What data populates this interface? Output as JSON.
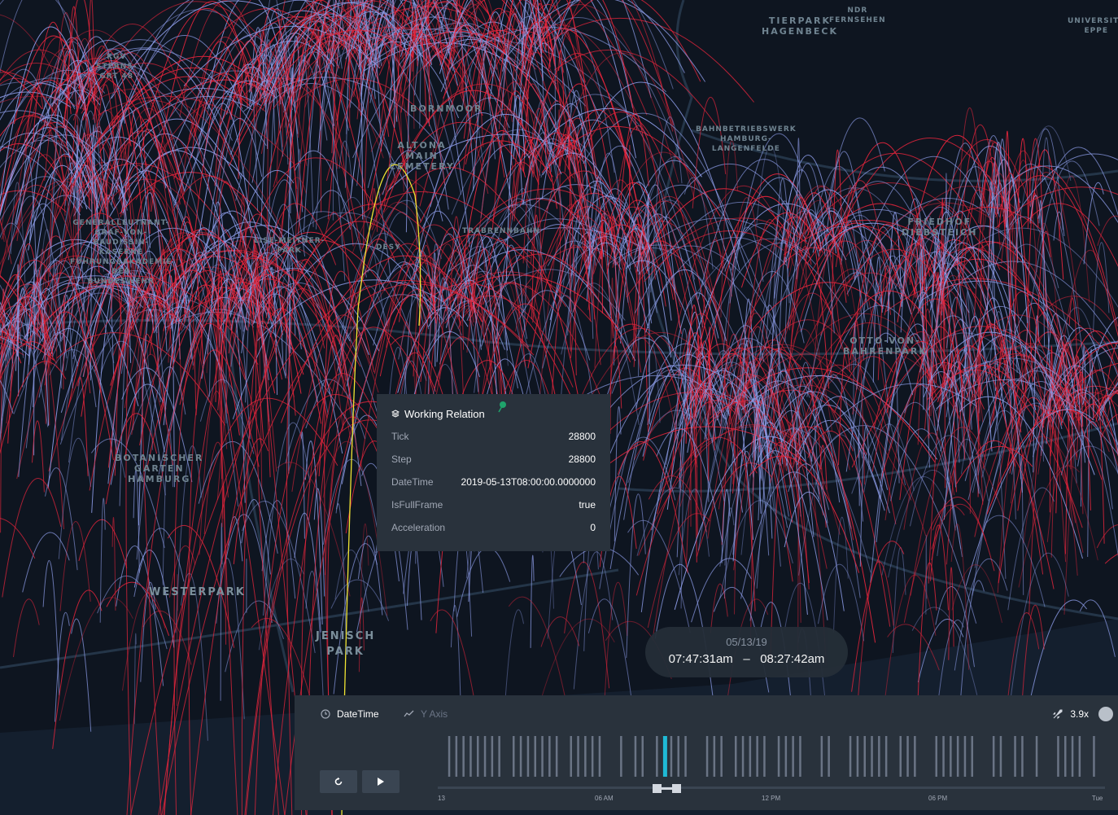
{
  "map": {
    "labels": [
      {
        "id": "kgv",
        "text": "KGV\nSTERNS-\nGRT 48",
        "size": "small"
      },
      {
        "id": "bornmoor",
        "text": "BORNMOOR",
        "size": "normal"
      },
      {
        "id": "altona",
        "text": "ALTONA\nMAIN\nCEMETERY",
        "size": "normal"
      },
      {
        "id": "tierpark",
        "text": "TIERPARK\nHAGENBECK",
        "size": "normal"
      },
      {
        "id": "ndr",
        "text": "NDR\nFERNSEHEN",
        "size": "small"
      },
      {
        "id": "univ",
        "text": "UNIVERSITÄ\nEPPE",
        "size": "small"
      },
      {
        "id": "bahn",
        "text": "BAHNBETRIEBSWERK\nHAMBURG-\nLANGENFELDE",
        "size": "small"
      },
      {
        "id": "kaserne",
        "text": "GENERALLEUTNANT-\nGRAF-VON-\nBAUDISSIN-\nKASERNE\nFÜHRUNGSAKADEMIE\nDER\nBUNDESWEHR",
        "size": "small"
      },
      {
        "id": "lise",
        "text": "LISE-MEITNER-\nPARK",
        "size": "small"
      },
      {
        "id": "desy",
        "text": "DESY",
        "size": "small"
      },
      {
        "id": "trabrenn",
        "text": "TRABRENNBAHN",
        "size": "small"
      },
      {
        "id": "friedhof",
        "text": "FRIEDHOF\nDIEBSTEICH",
        "size": "normal"
      },
      {
        "id": "otto",
        "text": "OTTO-VON-\nBAHRENPARK",
        "size": "normal"
      },
      {
        "id": "botanischer",
        "text": "BOTANISCHER\nGARTEN\nHAMBURG",
        "size": "normal"
      },
      {
        "id": "westerpark",
        "text": "WESTERPARK",
        "size": "big"
      },
      {
        "id": "jenisch",
        "text": "JENISCH\nPARK",
        "size": "big"
      }
    ],
    "colors": {
      "background": "#0e1520",
      "arc_red": "#e8253c",
      "arc_blue": "#8d9ce8",
      "highlight": "#f2e633",
      "road": "#2a3d52"
    }
  },
  "tooltip": {
    "title": "Working Relation",
    "icon": "layers-icon",
    "pin_icon": "pin-icon",
    "rows": [
      {
        "label": "Tick",
        "value": "28800"
      },
      {
        "label": "Step",
        "value": "28800"
      },
      {
        "label": "DateTime",
        "value": "2019-05-13T08:00:00.0000000"
      },
      {
        "label": "IsFullFrame",
        "value": "true"
      },
      {
        "label": "Acceleration",
        "value": "0"
      }
    ]
  },
  "time_display": {
    "date": "05/13/19",
    "start": "07:47:31am",
    "separator": "–",
    "end": "08:27:42am"
  },
  "time_panel": {
    "field_label": "DateTime",
    "field_icon": "clock-icon",
    "yaxis_label": "Y Axis",
    "yaxis_icon": "line-chart-icon",
    "speed_label": "3.9x",
    "speed_icon": "rocket-icon",
    "settings_icon": "settings-icon",
    "reset_icon": "reset-icon",
    "play_icon": "play-icon",
    "tick_labels": [
      "13",
      "06 AM",
      "12 PM",
      "06 PM",
      "Tue"
    ],
    "selection_fraction": [
      0.328,
      0.357
    ],
    "colors": {
      "bar": "#6a7485",
      "bar_selected": "#1fbad6",
      "panel": "#29323c"
    }
  }
}
